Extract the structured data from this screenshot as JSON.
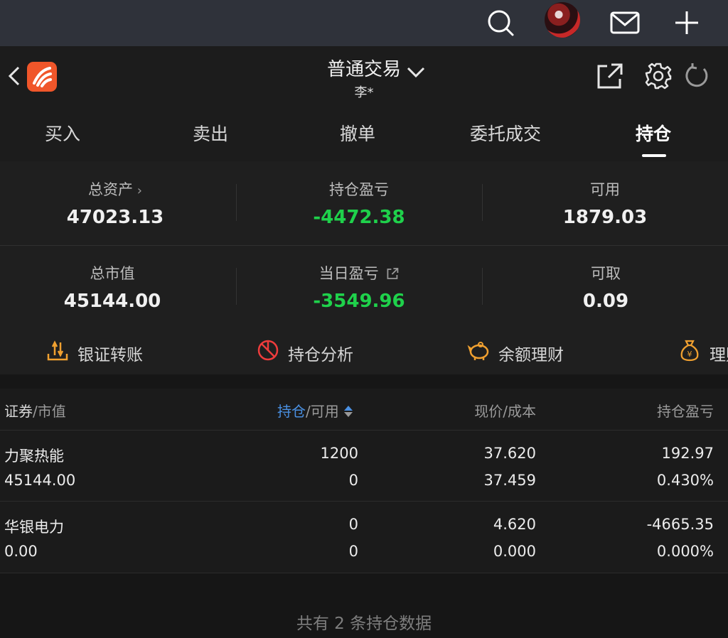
{
  "header": {
    "title": "普通交易",
    "subtitle": "李*"
  },
  "tabs": [
    {
      "label": "买入"
    },
    {
      "label": "卖出"
    },
    {
      "label": "撤单"
    },
    {
      "label": "委托成交"
    },
    {
      "label": "持仓"
    }
  ],
  "summary": {
    "total_assets": {
      "label": "总资产",
      "value": "47023.13"
    },
    "position_pl": {
      "label": "持仓盈亏",
      "value": "-4472.38"
    },
    "available": {
      "label": "可用",
      "value": "1879.03"
    },
    "market_value": {
      "label": "总市值",
      "value": "45144.00"
    },
    "daily_pl": {
      "label": "当日盈亏",
      "value": "-3549.96"
    },
    "withdrawable": {
      "label": "可取",
      "value": "0.09"
    }
  },
  "actions": [
    {
      "label": "银证转账",
      "icon": "transfer-icon"
    },
    {
      "label": "持仓分析",
      "icon": "pie-chart-icon"
    },
    {
      "label": "余额理财",
      "icon": "piggy-bank-icon"
    },
    {
      "label": "理财",
      "icon": "money-bag-icon"
    }
  ],
  "table": {
    "headers": {
      "col1_main": "证券",
      "col1_sub": "/市值",
      "col2_main": "持仓",
      "col2_sub": "/可用",
      "col3": "现价/成本",
      "col4": "持仓盈亏"
    },
    "rows": [
      {
        "name": "力聚热能",
        "market_value": "45144.00",
        "position": "1200",
        "available": "0",
        "price": "37.620",
        "cost": "37.459",
        "pl": "192.97",
        "pl_pct": "0.430%"
      },
      {
        "name": "华银电力",
        "market_value": "0.00",
        "position": "0",
        "available": "0",
        "price": "4.620",
        "cost": "0.000",
        "pl": "-4665.35",
        "pl_pct": "0.000%"
      }
    ],
    "footer": "共有 2 条持仓数据"
  },
  "colors": {
    "accent_orange": "#f0562a",
    "gain": "#ee2c2c",
    "loss": "#1fd14b",
    "link_blue": "#4a90e2",
    "action_orange": "#f0a030"
  }
}
